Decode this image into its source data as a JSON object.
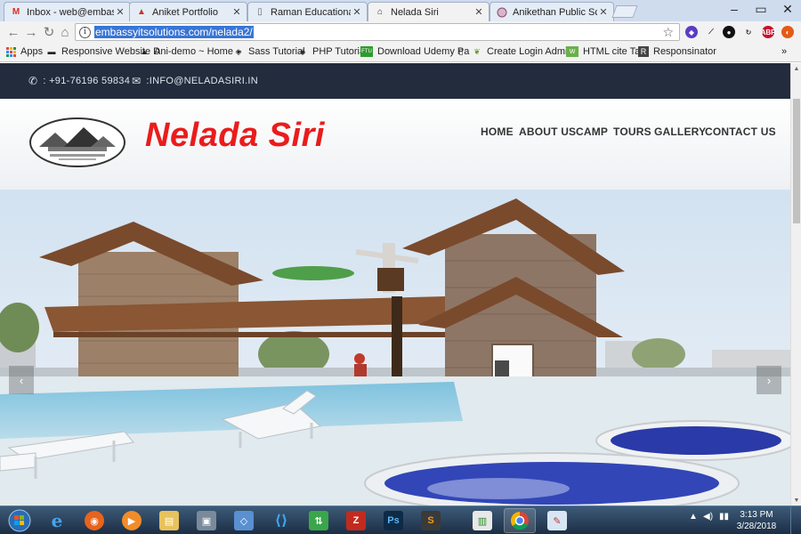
{
  "browser": {
    "tabs": [
      {
        "title": "Inbox - web@embassyit",
        "icon": "gmail-icon",
        "active": false
      },
      {
        "title": "Aniket Portfolio",
        "icon": "portfolio-icon",
        "active": false
      },
      {
        "title": "Raman Educational Instit",
        "icon": "document-icon",
        "active": false
      },
      {
        "title": "Nelada Siri",
        "icon": "nelada-siri-icon",
        "active": true
      },
      {
        "title": "Anikethan Public School",
        "icon": "school-icon",
        "active": false
      }
    ],
    "url": "embassyitsolutions.com/nelada2/",
    "bookmarks": [
      {
        "label": "Apps",
        "icon": "apps-grid-icon"
      },
      {
        "label": "Responsive Website D",
        "icon": "car-icon"
      },
      {
        "label": "Ani-demo ~ Home ~",
        "icon": "black-hat-icon"
      },
      {
        "label": "Sass Tutorial",
        "icon": "diamond-icon"
      },
      {
        "label": "PHP Tutorial",
        "icon": "diamond-icon"
      },
      {
        "label": "Download Udemy Pa",
        "icon": "ftu-icon"
      },
      {
        "label": "",
        "icon": "page-icon"
      },
      {
        "label": "Create Login Admin",
        "icon": "leaf-icon"
      },
      {
        "label": "HTML cite Tag",
        "icon": "w3c-icon"
      },
      {
        "label": "Responsinator",
        "icon": "r-icon"
      }
    ]
  },
  "site": {
    "topbar": {
      "phone": ": +91-76196 59834",
      "email": ":INFO@NELADASIRI.IN"
    },
    "brand": "Nelada Siri",
    "nav": [
      "HOME",
      "ABOUT US",
      "CAMP",
      "TOURS",
      "GALLERY",
      "CONTACT US"
    ],
    "hero": {
      "prev_label": "‹",
      "next_label": "›"
    }
  },
  "taskbar": {
    "apps": [
      "windows-start",
      "internet-explorer",
      "firefox",
      "media-player",
      "file-explorer",
      "app-manager",
      "virtualbox",
      "vs-code",
      "sync-app",
      "filezilla",
      "photoshop",
      "sublime-text",
      "task-manager",
      "chrome",
      "paint"
    ],
    "active_app": "chrome",
    "time": "3:13 PM",
    "date": "3/28/2018"
  },
  "colors": {
    "brand_red": "#ea1c1c",
    "topbar_bg": "#222c3d",
    "taskbar_bg": "#2a425e"
  }
}
